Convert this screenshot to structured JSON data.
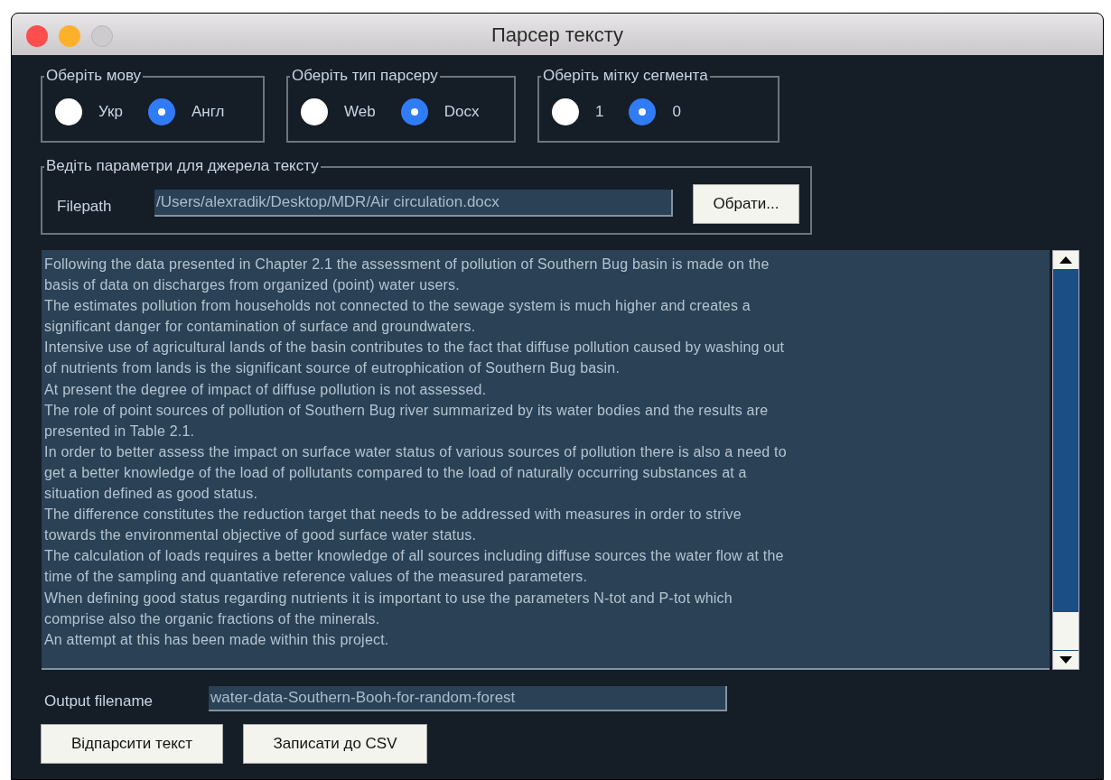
{
  "window": {
    "title": "Парсер тексту"
  },
  "radio_groups": [
    {
      "legend": "Оберіть мову",
      "options": [
        {
          "label": "Укр",
          "selected": false
        },
        {
          "label": "Англ",
          "selected": true
        }
      ]
    },
    {
      "legend": "Оберіть тип парсеру",
      "options": [
        {
          "label": "Web",
          "selected": false
        },
        {
          "label": "Docx",
          "selected": true
        }
      ]
    },
    {
      "legend": "Оберіть мітку сегмента",
      "options": [
        {
          "label": "1",
          "selected": false
        },
        {
          "label": "0",
          "selected": true
        }
      ]
    }
  ],
  "source": {
    "legend": "Ведіть параметри для джерела тексту",
    "label": "Filepath",
    "value": "/Users/alexradik/Desktop/MDR/Air circulation.docx",
    "button": "Обрати..."
  },
  "text_area": {
    "lines": [
      "Following the data presented in Chapter 2.1 the assessment of pollution of Southern Bug basin is made on the",
      "basis of data on discharges from organized (point) water users.",
      "The estimates pollution from households not connected to the sewage system is much higher and creates a",
      "significant danger for contamination of surface and groundwaters.",
      "Intensive use of agricultural lands of the basin contributes to the fact that diffuse pollution caused by washing out",
      "of nutrients from lands is the significant source of eutrophication of Southern Bug basin.",
      "At present the degree of impact of diffuse pollution is not assessed.",
      "The role of point sources of pollution of Southern Bug river summarized by its water bodies and the results are",
      "presented in Table 2.1.",
      "In order to better assess the impact on surface water status of various sources of pollution there is also a need to",
      "get a better knowledge of the load of pollutants compared to the load of naturally occurring substances at a",
      "situation defined as good status.",
      "The difference constitutes the reduction target that needs to be addressed with measures in order to strive",
      "towards the environmental objective of good surface water status.",
      "The calculation of loads requires a better knowledge of all sources including diffuse sources the water flow at the",
      "time of the sampling and quantative reference values of the measured parameters.",
      "When defining good status regarding nutrients it is important to use the parameters N-tot and P-tot which",
      "comprise also the organic fractions of the minerals.",
      "An attempt at this has been made within this project."
    ]
  },
  "output": {
    "label": "Output filename",
    "value": "water-data-Southern-Booh-for-random-forest"
  },
  "buttons": [
    "Відпарсити текст",
    "Записати до CSV"
  ]
}
